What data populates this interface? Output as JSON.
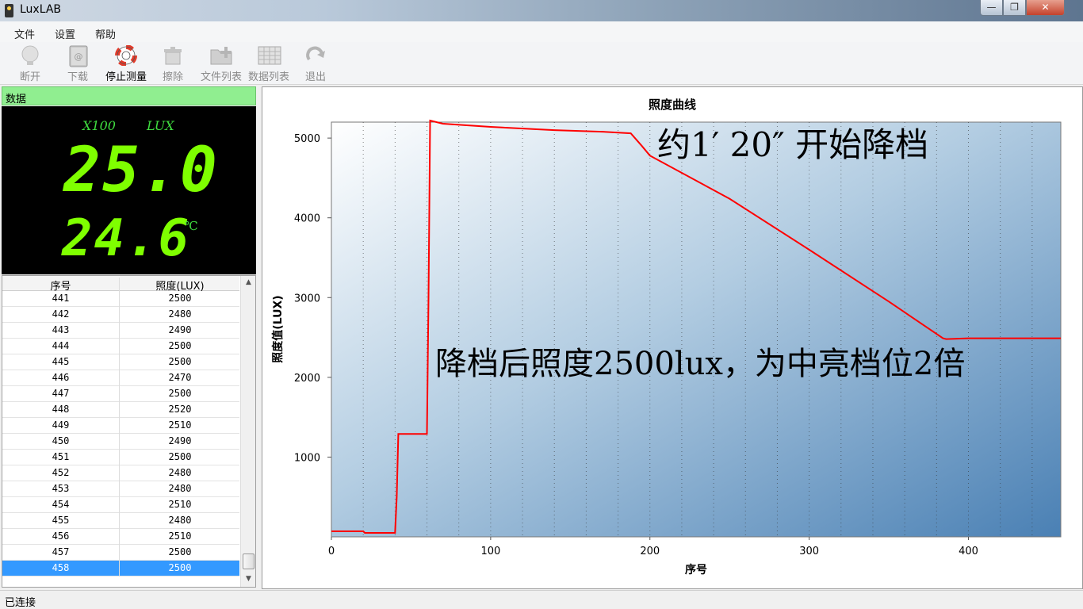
{
  "window": {
    "title": "LuxLAB"
  },
  "menu": [
    "文件",
    "设置",
    "帮助"
  ],
  "toolbar": [
    {
      "label": "断开",
      "icon": "bulb-icon",
      "enabled": false
    },
    {
      "label": "下载",
      "icon": "book-icon",
      "enabled": false
    },
    {
      "label": "停止测量",
      "icon": "lifebuoy-icon",
      "enabled": true
    },
    {
      "label": "擦除",
      "icon": "erase-icon",
      "enabled": false
    },
    {
      "label": "文件列表",
      "icon": "folder-add-icon",
      "enabled": false
    },
    {
      "label": "数据列表",
      "icon": "table-icon",
      "enabled": false
    },
    {
      "label": "退出",
      "icon": "refresh-icon",
      "enabled": false
    }
  ],
  "data_panel": {
    "header": "数据",
    "multiplier": "X100",
    "unit": "LUX",
    "lux_value": "25.0",
    "temp_value": "24.6",
    "temp_unit": "℃"
  },
  "table": {
    "columns": [
      "序号",
      "照度(LUX)"
    ],
    "rows": [
      [
        "441",
        "2500"
      ],
      [
        "442",
        "2480"
      ],
      [
        "443",
        "2490"
      ],
      [
        "444",
        "2500"
      ],
      [
        "445",
        "2500"
      ],
      [
        "446",
        "2470"
      ],
      [
        "447",
        "2500"
      ],
      [
        "448",
        "2520"
      ],
      [
        "449",
        "2510"
      ],
      [
        "450",
        "2490"
      ],
      [
        "451",
        "2500"
      ],
      [
        "452",
        "2480"
      ],
      [
        "453",
        "2480"
      ],
      [
        "454",
        "2510"
      ],
      [
        "455",
        "2480"
      ],
      [
        "456",
        "2510"
      ],
      [
        "457",
        "2500"
      ],
      [
        "458",
        "2500"
      ]
    ],
    "selected_row": "458"
  },
  "chart_data": {
    "type": "line",
    "title": "照度曲线",
    "xlabel": "序号",
    "ylabel": "照度值(LUX)",
    "xlim": [
      0,
      458
    ],
    "ylim": [
      0,
      5200
    ],
    "xticks": [
      0,
      100,
      200,
      300,
      400
    ],
    "yticks": [
      1000,
      2000,
      3000,
      4000,
      5000
    ],
    "grid": "vertical-dotted",
    "series": [
      {
        "color": "#ff0000",
        "x": [
          0,
          20,
          21,
          40,
          41,
          42,
          60,
          61,
          62,
          70,
          100,
          140,
          170,
          188,
          195,
          200,
          250,
          300,
          350,
          384,
          386,
          400,
          420,
          440,
          458
        ],
        "y": [
          70,
          70,
          50,
          50,
          500,
          1290,
          1290,
          3000,
          5220,
          5180,
          5140,
          5100,
          5080,
          5060,
          4900,
          4780,
          4240,
          3600,
          2950,
          2490,
          2480,
          2490,
          2490,
          2490,
          2490
        ]
      }
    ],
    "annotations": [
      "约1′ 20″ 开始降档",
      "降档后照度2500lux，为中亮档位2倍"
    ]
  },
  "status": "已连接"
}
